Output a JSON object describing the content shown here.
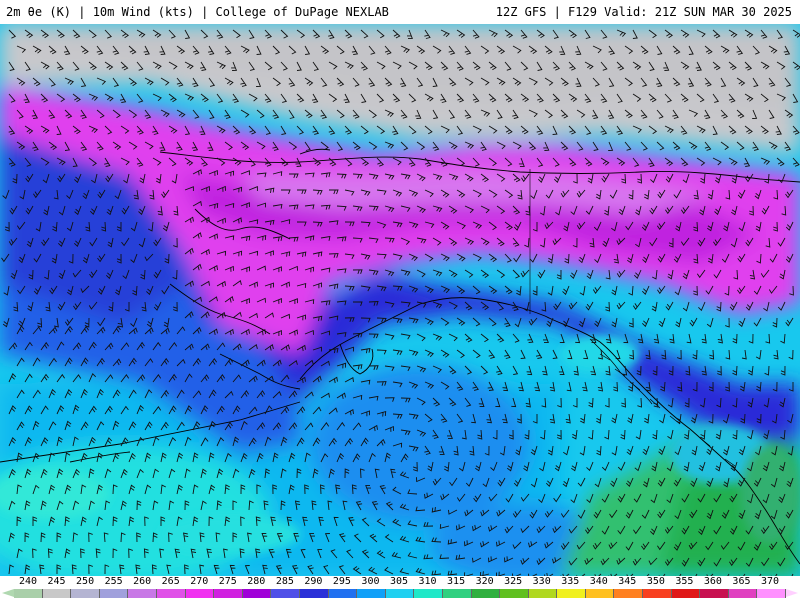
{
  "header": {
    "left_title": "2m θe (K) | 10m Wind (kts) | College of DuPage NEXLAB",
    "right_title": "12Z GFS | F129 Valid: 21Z SUN MAR 30 2025"
  },
  "map": {
    "region": "Alaska / Gulf of Alaska",
    "icons": [
      "wind-barb-icon",
      "coastline"
    ]
  },
  "colorbar": {
    "labels": [
      "240",
      "245",
      "250",
      "255",
      "260",
      "265",
      "270",
      "275",
      "280",
      "285",
      "290",
      "295",
      "300",
      "305",
      "310",
      "315",
      "320",
      "325",
      "330",
      "335",
      "340",
      "345",
      "350",
      "355",
      "360",
      "365",
      "370"
    ],
    "colors": [
      "#a9cfa9",
      "#c8c8c8",
      "#b4b4d2",
      "#a0a0dc",
      "#c878e6",
      "#e050e8",
      "#f030f0",
      "#d020e0",
      "#a000d8",
      "#5050e8",
      "#2a30d8",
      "#2070f0",
      "#10a0f8",
      "#20d0f0",
      "#20e8c8",
      "#30d080",
      "#30b040",
      "#60c020",
      "#b0d820",
      "#f0f020",
      "#ffc020",
      "#ff8020",
      "#f84020",
      "#e01818",
      "#c81050",
      "#e040c0",
      "#ff90ff"
    ]
  }
}
